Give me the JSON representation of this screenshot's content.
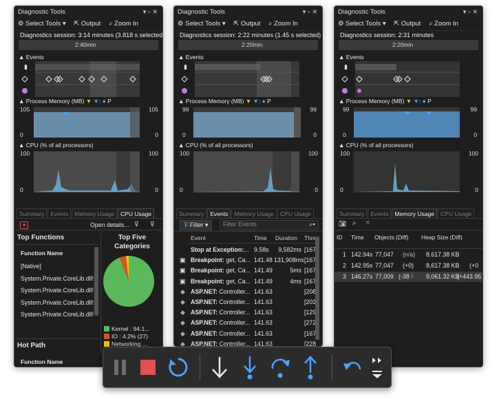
{
  "windows": [
    {
      "title": "Diagnostic Tools",
      "toolbar": {
        "select_tools": "Select Tools",
        "output": "Output",
        "zoom_in": "Zoom In",
        "zoom_out": "Z"
      },
      "session": "Diagnostics session: 3:14 minutes (3.818 s selected)",
      "ruler_label": "2:40min",
      "events_label": "Events",
      "memory_label": "Process Memory (MB)",
      "memory_y_top": "105",
      "memory_y_bottom": "0",
      "cpu_label": "CPU (% of all processors)",
      "cpu_y_top": "100",
      "cpu_y_bottom": "0",
      "tabs": [
        "Summary",
        "Events",
        "Memory Usage",
        "CPU Usage"
      ],
      "active_tab": "CPU Usage",
      "open_details": "Open details...",
      "top_functions_heading": "Top Functions",
      "function_name_header": "Function Name",
      "functions": [
        "[Native]",
        "System.Private.CoreLib.dll!",
        "System.Private.CoreLib.dll!",
        "System.Private.CoreLib.dll!",
        "System.Private.CoreLib.dll!"
      ],
      "top_five_heading": "Top Five Categories",
      "pie": [
        {
          "label": "Kernel : 94.1...",
          "value": 94.1,
          "color": "#5cb85c"
        },
        {
          "label": "IO : 4.2% (27)",
          "value": 4.2,
          "color": "#d9531e"
        },
        {
          "label": "Networking ...",
          "value": 1.7,
          "color": "#f0c419"
        }
      ],
      "hot_path_heading": "Hot Path",
      "hot_path_header": "Function Name"
    },
    {
      "title": "Diagnostic Tools",
      "toolbar": {
        "select_tools": "Select Tools",
        "output": "Output",
        "zoom_in": "Zoom In",
        "zoom_out": "Z"
      },
      "session": "Diagnostics session: 2:22 minutes (1.45 s selected)",
      "ruler_label": "2:20min",
      "events_label": "Events",
      "memory_label": "Process Memory (MB)",
      "memory_y_top": "99",
      "memory_y_bottom": "0",
      "cpu_label": "CPU (% of all processors)",
      "cpu_y_top": "100",
      "cpu_y_bottom": "0",
      "tabs": [
        "Summary",
        "Events",
        "Memory Usage",
        "CPU Usage"
      ],
      "active_tab": "Events",
      "filter_label": "Filter",
      "filter_placeholder": "Filter Events",
      "event_headers": [
        "Event",
        "Time",
        "Duration",
        "Thre"
      ],
      "events": [
        {
          "icon": "none",
          "bold": "Stop at Exception:",
          "rest": "...",
          "time": "9.58s",
          "duration": "9,582ms",
          "thread": "[167"
        },
        {
          "icon": "camera",
          "bold": "Breakpoint:",
          "rest": " get, Ca...",
          "time": "141.48",
          "duration": "131,908ms",
          "thread": "[167"
        },
        {
          "icon": "camera",
          "bold": "Breakpoint:",
          "rest": " get, Ca...",
          "time": "141.49",
          "duration": "5ms",
          "thread": "[167"
        },
        {
          "icon": "camera",
          "bold": "Breakpoint:",
          "rest": " get, Ca...",
          "time": "141.49",
          "duration": "4ms",
          "thread": "[167"
        },
        {
          "icon": "diamond",
          "bold": "ASP.NET:",
          "rest": " Controller...",
          "time": "141.63",
          "duration": "",
          "thread": "[208"
        },
        {
          "icon": "diamond",
          "bold": "ASP.NET:",
          "rest": " Controller...",
          "time": "141.63",
          "duration": "",
          "thread": "[203"
        },
        {
          "icon": "diamond",
          "bold": "ASP.NET:",
          "rest": " Controller...",
          "time": "141.63",
          "duration": "",
          "thread": "[129"
        },
        {
          "icon": "diamond",
          "bold": "ASP.NET:",
          "rest": " Controller...",
          "time": "141.63",
          "duration": "",
          "thread": "[272"
        },
        {
          "icon": "diamond",
          "bold": "ASP.NET:",
          "rest": " Controller...",
          "time": "141.63",
          "duration": "",
          "thread": "[167"
        },
        {
          "icon": "diamond",
          "bold": "ASP.NET:",
          "rest": " Controller...",
          "time": "141.63",
          "duration": "",
          "thread": "[228"
        }
      ]
    },
    {
      "title": "Diagnostic Tools",
      "toolbar": {
        "select_tools": "Select Tools",
        "output": "Output",
        "zoom_in": "Zoom In",
        "zoom_out": "Z"
      },
      "session": "Diagnostics session: 2:31 minutes",
      "ruler_label": "2:20min",
      "events_label": "Events",
      "memory_label": "Process Memory (MB)",
      "memory_y_top": "99",
      "memory_y_bottom": "0",
      "cpu_label": "CPU (% of all processors)",
      "cpu_y_top": "100",
      "cpu_y_bottom": "0",
      "tabs": [
        "Summary",
        "Events",
        "Memory Usage",
        "CPU Usage"
      ],
      "active_tab": "Memory Usage",
      "snapshot_headers": [
        "ID",
        "Time",
        "Objects (Diff)",
        "Heap Size (Diff)"
      ],
      "snapshots": [
        {
          "id": "1",
          "time": "142.94s",
          "objects": "77,047",
          "objects_diff": "(n/a)",
          "heap": "8,617.38 KB",
          "heap_diff": ""
        },
        {
          "id": "2",
          "time": "142.95s",
          "objects": "77,047",
          "objects_diff": "(+0)",
          "heap": "8,617.38 KB",
          "heap_diff": "(+0"
        },
        {
          "id": "3",
          "time": "146.27s",
          "objects": "77,009",
          "objects_diff": "(-38",
          "heap": "9,061.32 KB",
          "heap_diff": "(+443.95"
        }
      ]
    }
  ],
  "debug_toolbar": {
    "buttons": [
      "pause",
      "stop",
      "restart",
      "step-into",
      "step-into-specific",
      "step-over",
      "step-out",
      "step-back"
    ],
    "colors": {
      "accent": "#4da3ff",
      "stop": "#e05252"
    }
  }
}
